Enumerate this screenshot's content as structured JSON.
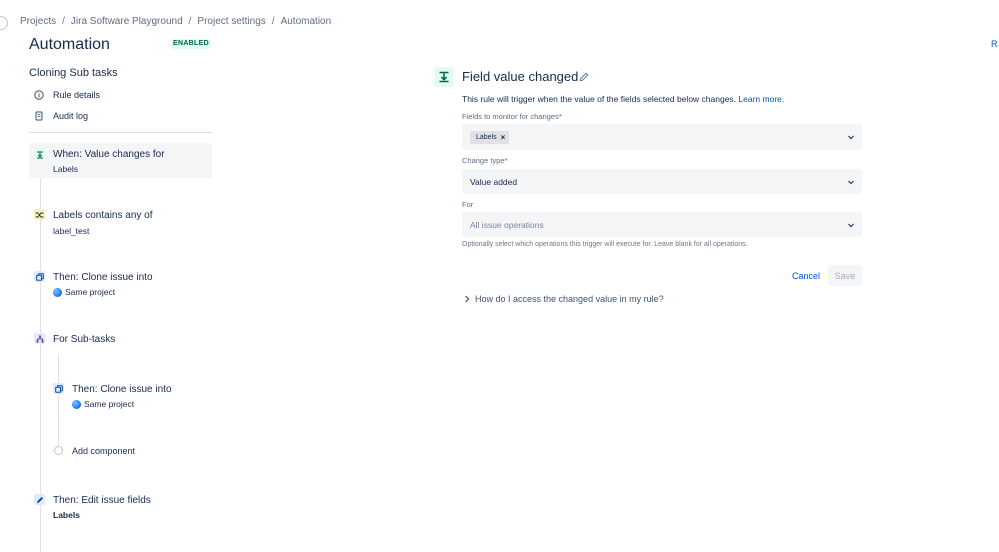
{
  "breadcrumbs": [
    "Projects",
    "Jira Software Playground",
    "Project settings",
    "Automation"
  ],
  "header": {
    "title": "Automation",
    "status_badge": "ENABLED",
    "edge_text": "R"
  },
  "sidebar": {
    "rule_name": "Cloning Sub tasks",
    "menu": [
      {
        "label": "Rule details",
        "icon": "info-icon"
      },
      {
        "label": "Audit log",
        "icon": "document-icon"
      }
    ]
  },
  "components": {
    "trigger": {
      "title": "When: Value changes for",
      "subtitle": "Labels",
      "icon": "trigger-icon",
      "color": "#e3fcef"
    },
    "condition": {
      "title": "Labels contains any of",
      "subtitle": "label_test",
      "icon": "condition-icon",
      "color": "#fff0b3"
    },
    "clone1": {
      "title": "Then: Clone issue into",
      "subtitle": "Same project",
      "icon": "clone-icon",
      "color": "#deebff"
    },
    "branch": {
      "title": "For Sub-tasks",
      "icon": "branch-icon",
      "color": "#eae6ff"
    },
    "clone2": {
      "title": "Then: Clone issue into",
      "subtitle": "Same project",
      "icon": "clone-icon",
      "color": "#deebff"
    },
    "add": {
      "label": "Add component"
    },
    "edit": {
      "title": "Then: Edit issue fields",
      "subtitle": "Labels",
      "icon": "pencil-icon",
      "color": "#deebff"
    }
  },
  "panel": {
    "title": "Field value changed",
    "description": "This rule will trigger when the value of the fields selected below changes.",
    "learn_more": "Learn more.",
    "fields_label": "Fields to monitor for changes",
    "required_mark": "*",
    "fields_tag": "Labels",
    "change_type_label": "Change type",
    "change_type_value": "Value added",
    "for_label": "For",
    "for_placeholder": "All issue operations",
    "for_help": "Optionally select which operations this trigger will execute for. Leave blank for all operations.",
    "cancel_label": "Cancel",
    "save_label": "Save",
    "expander_label": "How do I access the changed value in my rule?"
  }
}
